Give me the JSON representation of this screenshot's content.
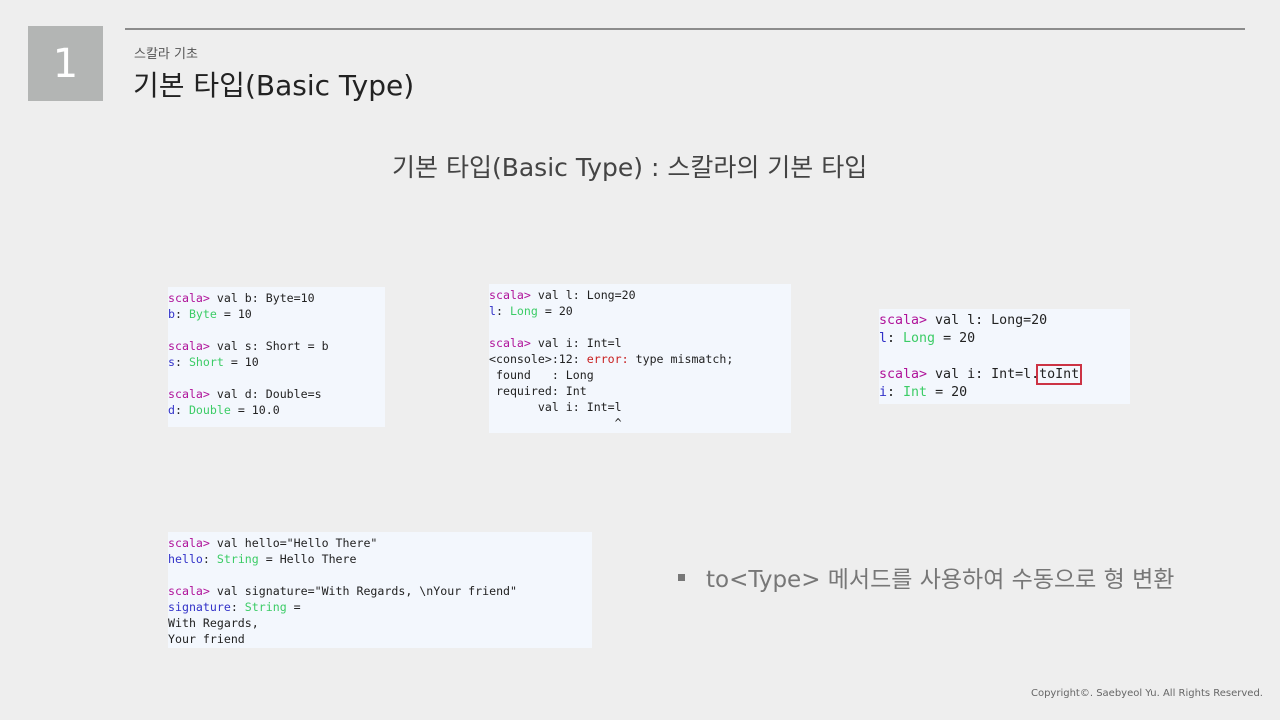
{
  "slide": {
    "number": "1",
    "subtitle": "스칼라 기초",
    "title": "기본 타입(Basic Type)",
    "heading": "기본 타입(Basic Type) : 스칼라의 기본 타입",
    "bullet_text": "to<Type> 메서드를 사용하여 수동으로 형 변환",
    "copyright": "Copyright©. Saebyeol Yu. All Rights Reserved."
  },
  "code_blocks": {
    "basic": {
      "lines": [
        [
          {
            "t": "scala>",
            "c": "prompt"
          },
          {
            "t": " val b: Byte=10",
            "c": ""
          }
        ],
        [
          {
            "t": "b",
            "c": "ident"
          },
          {
            "t": ": ",
            "c": ""
          },
          {
            "t": "Byte",
            "c": "type"
          },
          {
            "t": " = 10",
            "c": ""
          }
        ],
        [],
        [
          {
            "t": "scala>",
            "c": "prompt"
          },
          {
            "t": " val s: Short = b",
            "c": ""
          }
        ],
        [
          {
            "t": "s",
            "c": "ident"
          },
          {
            "t": ": ",
            "c": ""
          },
          {
            "t": "Short",
            "c": "type"
          },
          {
            "t": " = 10",
            "c": ""
          }
        ],
        [],
        [
          {
            "t": "scala>",
            "c": "prompt"
          },
          {
            "t": " val d: Double=s",
            "c": ""
          }
        ],
        [
          {
            "t": "d",
            "c": "ident"
          },
          {
            "t": ": ",
            "c": ""
          },
          {
            "t": "Double",
            "c": "type"
          },
          {
            "t": " = 10.0",
            "c": ""
          }
        ]
      ]
    },
    "error": {
      "lines": [
        [
          {
            "t": "scala>",
            "c": "prompt"
          },
          {
            "t": " val l: Long=20",
            "c": ""
          }
        ],
        [
          {
            "t": "l",
            "c": "ident"
          },
          {
            "t": ": ",
            "c": ""
          },
          {
            "t": "Long",
            "c": "type"
          },
          {
            "t": " = 20",
            "c": ""
          }
        ],
        [],
        [
          {
            "t": "scala>",
            "c": "prompt"
          },
          {
            "t": " val i: Int=l",
            "c": ""
          }
        ],
        [
          {
            "t": "<console>:12: ",
            "c": ""
          },
          {
            "t": "error:",
            "c": "err"
          },
          {
            "t": " type mismatch;",
            "c": ""
          }
        ],
        [
          {
            "t": " found   : Long",
            "c": ""
          }
        ],
        [
          {
            "t": " required: Int",
            "c": ""
          }
        ],
        [
          {
            "t": "       val i: Int=l",
            "c": ""
          }
        ],
        [
          {
            "t": "                  ^",
            "c": ""
          }
        ]
      ]
    },
    "toint": {
      "lines": [
        [
          {
            "t": "scala>",
            "c": "prompt"
          },
          {
            "t": " val l: Long=20",
            "c": ""
          }
        ],
        [
          {
            "t": "l",
            "c": "ident"
          },
          {
            "t": ": ",
            "c": ""
          },
          {
            "t": "Long",
            "c": "type"
          },
          {
            "t": " = 20",
            "c": ""
          }
        ],
        [],
        [
          {
            "t": "scala>",
            "c": "prompt"
          },
          {
            "t": " val i: Int=l.",
            "c": ""
          },
          {
            "t": "toInt",
            "c": "hl"
          }
        ],
        [
          {
            "t": "i",
            "c": "ident"
          },
          {
            "t": ": ",
            "c": ""
          },
          {
            "t": "Int",
            "c": "type"
          },
          {
            "t": " = 20",
            "c": ""
          }
        ]
      ]
    },
    "string": {
      "lines": [
        [
          {
            "t": "scala>",
            "c": "prompt"
          },
          {
            "t": " val hello=\"Hello There\"",
            "c": ""
          }
        ],
        [
          {
            "t": "hello",
            "c": "ident"
          },
          {
            "t": ": ",
            "c": ""
          },
          {
            "t": "String",
            "c": "type"
          },
          {
            "t": " = Hello There",
            "c": ""
          }
        ],
        [],
        [
          {
            "t": "scala>",
            "c": "prompt"
          },
          {
            "t": " val signature=\"With Regards, \\nYour friend\"",
            "c": ""
          }
        ],
        [
          {
            "t": "signature",
            "c": "ident"
          },
          {
            "t": ": ",
            "c": ""
          },
          {
            "t": "String",
            "c": "type"
          },
          {
            "t": " =",
            "c": ""
          }
        ],
        [
          {
            "t": "With Regards,",
            "c": ""
          }
        ],
        [
          {
            "t": "Your friend",
            "c": ""
          }
        ]
      ]
    }
  }
}
